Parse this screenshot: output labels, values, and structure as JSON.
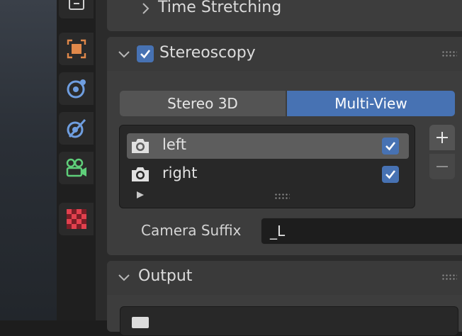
{
  "panels": {
    "time_stretching": {
      "title": "Time Stretching",
      "expanded": false
    },
    "stereoscopy": {
      "title": "Stereoscopy",
      "enabled": true,
      "expanded": true,
      "mode_tabs": [
        {
          "label": "Stereo 3D",
          "active": false
        },
        {
          "label": "Multi-View",
          "active": true
        }
      ],
      "views": [
        {
          "name": "left",
          "enabled": true,
          "selected": true
        },
        {
          "name": "right",
          "enabled": true,
          "selected": false
        }
      ],
      "add_icon": "plus-icon",
      "remove_icon": "minus-icon",
      "camera_suffix": {
        "label": "Camera Suffix",
        "value": "_L"
      }
    },
    "output": {
      "title": "Output",
      "expanded": true
    }
  },
  "tabs": [
    {
      "icon": "output-icon",
      "active": false
    },
    {
      "icon": "view-layer-icon",
      "active": false
    },
    {
      "icon": "scene-icon",
      "active": false
    },
    {
      "icon": "world-icon",
      "active": false
    },
    {
      "icon": "object-icon",
      "active": false
    },
    {
      "icon": "texture-icon",
      "active": false
    }
  ],
  "colors": {
    "accent": "#4772b3",
    "panel": "#3d3d3d",
    "background": "#2b2b2b"
  }
}
